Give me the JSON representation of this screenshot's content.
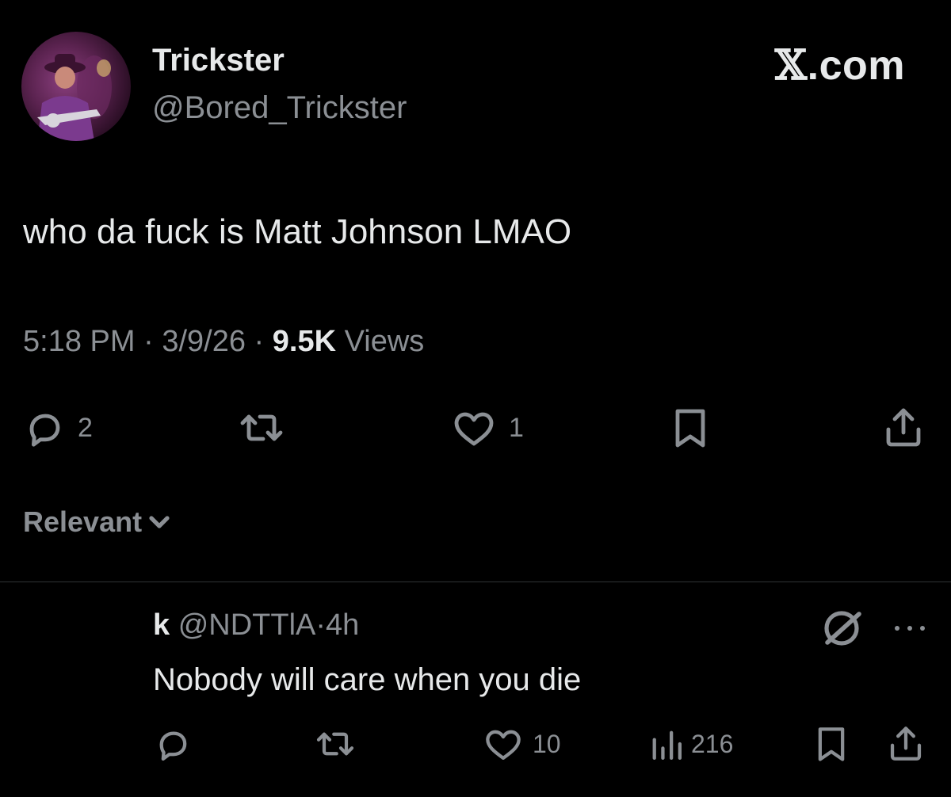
{
  "author": {
    "name": "Trickster",
    "handle": "@Bored_Trickster"
  },
  "brand": {
    "x_glyph": "𝕏",
    "domain": ".com"
  },
  "tweet": {
    "text": "who da fuck is Matt Johnson LMAO",
    "time": "5:18 PM",
    "date": "3/9/26",
    "views_count": "9.5K",
    "views_label": "Views",
    "separator": "·"
  },
  "actions": {
    "reply_count": "2",
    "retweet_count": "",
    "like_count": "1"
  },
  "sort": {
    "label": "Relevant"
  },
  "reply": {
    "name": "k",
    "handle": "@NDTTlA",
    "separator": "·",
    "age": "4h",
    "text": "Nobody will care when you die",
    "reply_count": "",
    "retweet_count": "",
    "like_count": "10",
    "views_count": "216"
  },
  "icons": {
    "reply": "reply-bubble-icon",
    "retweet": "retweet-icon",
    "like": "heart-icon",
    "bookmark": "bookmark-icon",
    "share": "share-icon",
    "views": "analytics-bars-icon",
    "grok": "grok-icon",
    "more": "more-dots-icon",
    "chevron": "chevron-down-icon"
  },
  "colors": {
    "background": "#000000",
    "text_primary": "#e7e9ea",
    "text_secondary": "#8b8f94",
    "divider": "#2f3336"
  }
}
